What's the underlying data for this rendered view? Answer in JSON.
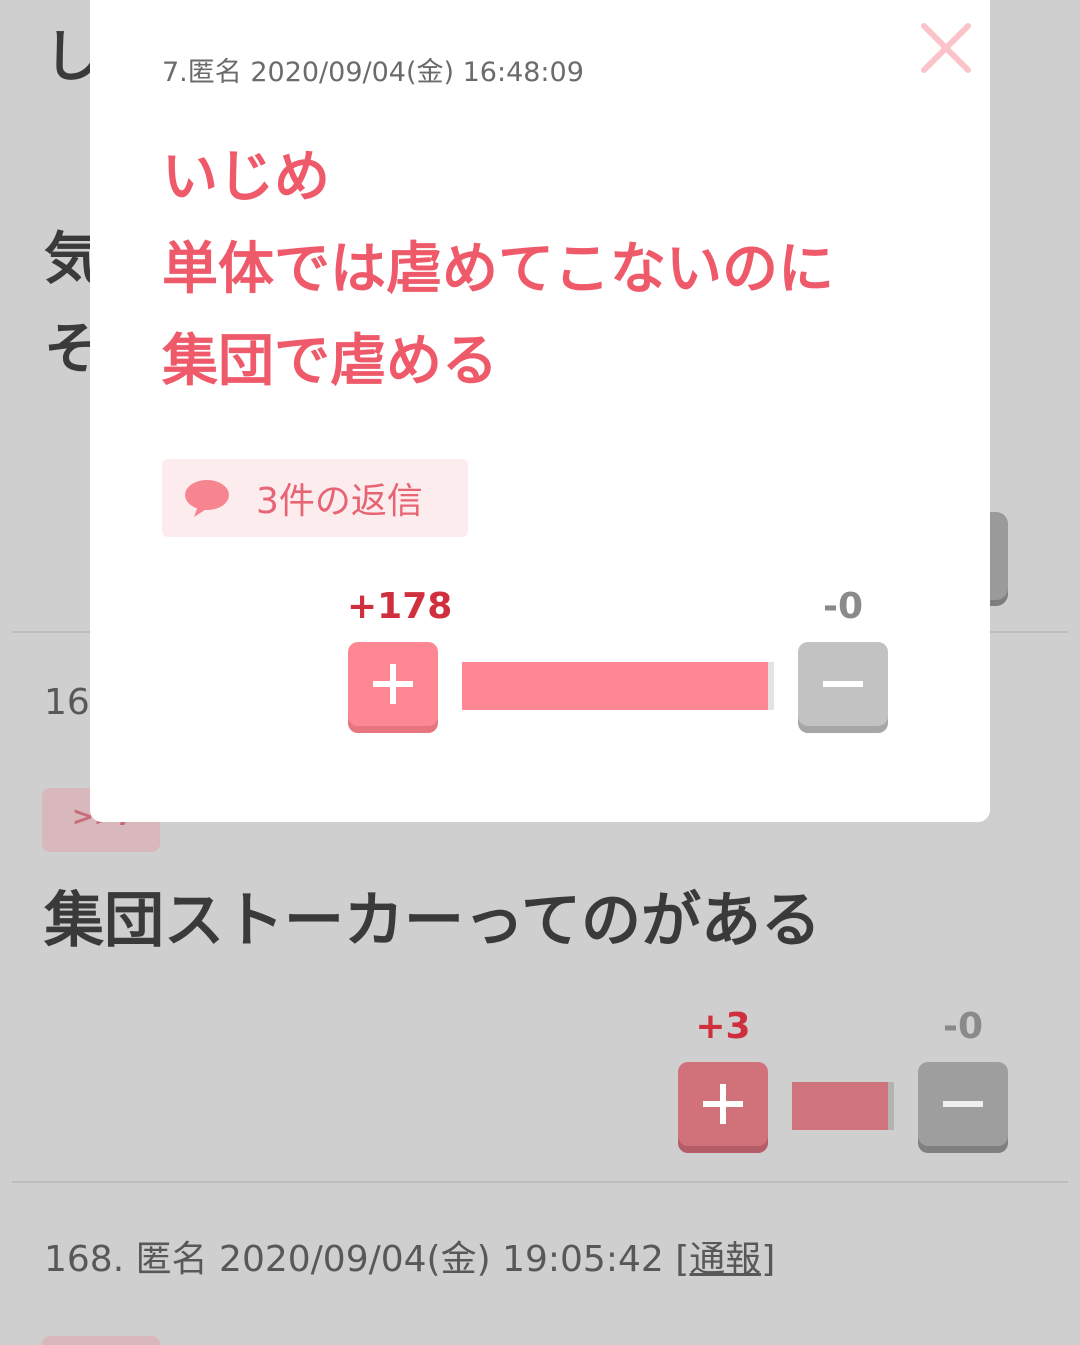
{
  "background": {
    "top_lines": [
      "し",
      "気",
      "そ"
    ],
    "post_167": {
      "number_partial": "16",
      "reply_tag": ">>7",
      "body": "集団ストーカーってのがある",
      "vote": {
        "plus_label": "+3",
        "minus_label": "-0",
        "plus_ratio": 1.0
      }
    },
    "post_168": {
      "meta": "168. 匿名 2020/09/04(金) 19:05:42 ",
      "report_link": "[通報]"
    }
  },
  "modal": {
    "meta": "7.匿名 2020/09/04(金) 16:48:09",
    "body_lines": [
      "いじめ",
      "単体では虐めてこないのに",
      "集団で虐める"
    ],
    "reply_button": "3件の返信",
    "vote": {
      "plus_label": "+178",
      "minus_label": "-0",
      "plus_ratio": 1.0
    },
    "icons": [
      "close-icon",
      "speech-bubble-icon",
      "plus-icon",
      "minus-icon"
    ]
  },
  "colors": {
    "accent_pink": "#ef5a6a",
    "plus_button": "#fd8893",
    "minus_button": "#c2c2c2",
    "close_icon": "#fbc4ca",
    "overlay": "#cfcfcf"
  }
}
